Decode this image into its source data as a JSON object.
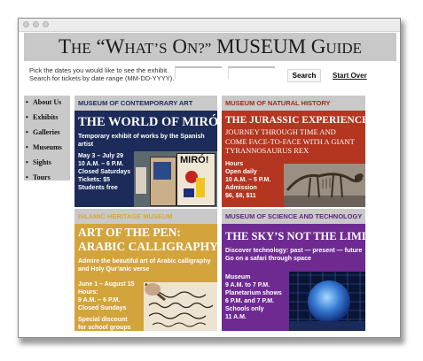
{
  "header": {
    "title_a": "T",
    "title_b": "HE",
    "title_c": " “W",
    "title_d": "HAT’S",
    "title_e": " O",
    "title_f": "N?”",
    "title_g": " MUSEUM G",
    "title_h": "UIDE"
  },
  "search": {
    "instruction_line1": "Pick the dates you would like to see the exhibit.",
    "instruction_line2": "Search for tickets by date range (MM-DD-YYYY).",
    "start_value": "",
    "end_value": "",
    "search_label": "Search",
    "start_over_label": "Start Over"
  },
  "sidebar": {
    "items": [
      {
        "label": "About Us"
      },
      {
        "label": "Exhibits"
      },
      {
        "label": "Galleries"
      },
      {
        "label": "Museums"
      },
      {
        "label": "Sights"
      },
      {
        "label": "Tours"
      }
    ]
  },
  "cards": [
    {
      "museum": "MUSEUM OF CONTEMPORARY ART",
      "title": "THE WORLD OF MIRÓ",
      "desc": "Temporary exhibit of works by the Spanish artist",
      "info": [
        "May 3 – July 29",
        "10 A.M. – 6 P.M.",
        "Closed Saturdays",
        "Tickets: $5",
        "Students free"
      ],
      "image_label": "MIRÓ!",
      "head_bg": "#c9c9c9",
      "head_color": "#1c2b5a",
      "body_bg": "#1c2b5a"
    },
    {
      "museum": "MUSEUM OF NATURAL HISTORY",
      "title": "THE JURASSIC EXPERIENCE",
      "sub": [
        "JOURNEY THROUGH TIME AND",
        "COME FACE-TO-FACE WITH A GIANT",
        "TYRANNOSAURUS REX"
      ],
      "info": [
        "Hours",
        "Open daily",
        "10 A.M. – 5 P.M.",
        "Admission",
        "$6, $8, $11"
      ],
      "head_bg": "#c9c9c9",
      "head_color": "#9b2a1a",
      "body_bg": "#b43520"
    },
    {
      "museum": "ISLAMIC HERITAGE MUSEUM",
      "title_lines": [
        "ART OF THE PEN:",
        "ARABIC CALLIGRAPHY"
      ],
      "desc": "Admire the beautiful art of Arabic calligraphy and Holy Qur’anic verse",
      "info": [
        "June 1 – August 15",
        "Hours:",
        "9 A.M. – 6 P.M.",
        "Closed Sundays"
      ],
      "extra": [
        "Special discount",
        "for school groups"
      ],
      "head_bg": "#c9c9c9",
      "head_color": "#d4a83c",
      "body_bg": "#d3a43c"
    },
    {
      "museum": "MUSEUM OF SCIENCE AND TECHNOLOGY",
      "title": "THE SKY’S NOT THE LIMIT",
      "desc": "Discover technology: past — present — future Go on a safari through space",
      "info": [
        "Museum",
        "9 A.M. to 7 P.M.",
        "Planetarium shows",
        "6 P.M. and 7 P.M.",
        "Schools only",
        "11 A.M."
      ],
      "head_bg": "#c9c9c9",
      "head_color": "#5e2282",
      "body_bg": "#6f2a92"
    }
  ]
}
